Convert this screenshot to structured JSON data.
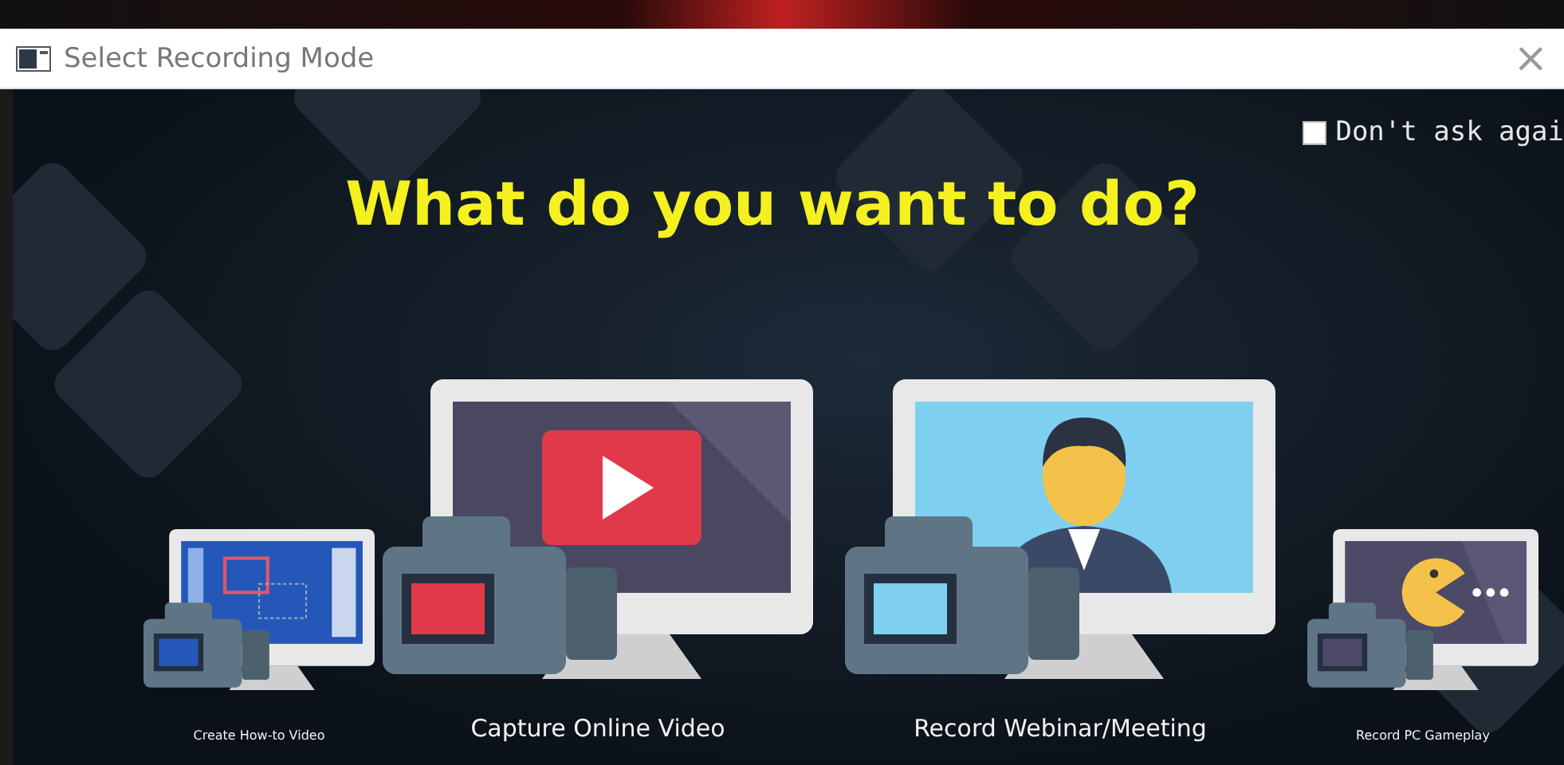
{
  "window": {
    "title": "Select Recording Mode",
    "close": "×"
  },
  "dont_ask": {
    "label": "Don't ask agai",
    "checked": false
  },
  "heading": "What do you want to do?",
  "options": [
    {
      "kind": "howto",
      "label": "Create How-to Video"
    },
    {
      "kind": "online",
      "label": "Capture Online Video"
    },
    {
      "kind": "webinar",
      "label": "Record Webinar/Meeting"
    },
    {
      "kind": "gameplay",
      "label": "Record PC Gameplay"
    }
  ]
}
